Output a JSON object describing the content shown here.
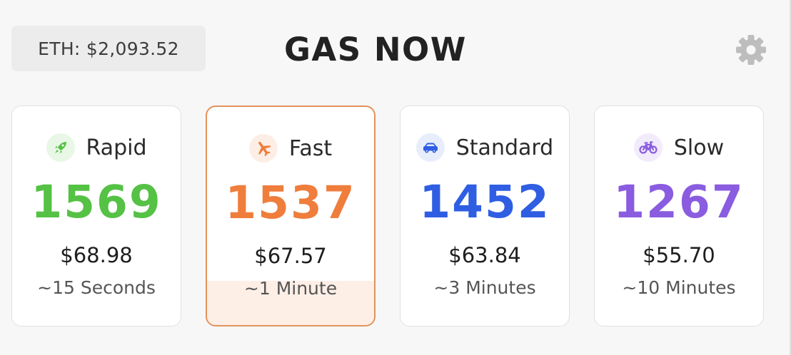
{
  "header": {
    "eth_price": "ETH: $2,093.52",
    "title": "GAS NOW",
    "settings_icon": "gear-icon"
  },
  "tiers": [
    {
      "label": "Rapid",
      "icon": "rocket-icon",
      "gwei": "1569",
      "usd": "$68.98",
      "time": "~15 Seconds",
      "color": "#55c145",
      "badge_bg": "#e9f7e6",
      "selected": false
    },
    {
      "label": "Fast",
      "icon": "airplane-icon",
      "gwei": "1537",
      "usd": "$67.57",
      "time": "~1 Minute",
      "color": "#ef7d3c",
      "badge_bg": "#fdeee5",
      "selected": true
    },
    {
      "label": "Standard",
      "icon": "car-icon",
      "gwei": "1452",
      "usd": "$63.84",
      "time": "~3 Minutes",
      "color": "#2f5ee3",
      "badge_bg": "#e7edfb",
      "selected": false
    },
    {
      "label": "Slow",
      "icon": "bicycle-icon",
      "gwei": "1267",
      "usd": "$55.70",
      "time": "~10 Minutes",
      "color": "#8a5ce0",
      "badge_bg": "#f1ebfb",
      "selected": false
    }
  ]
}
